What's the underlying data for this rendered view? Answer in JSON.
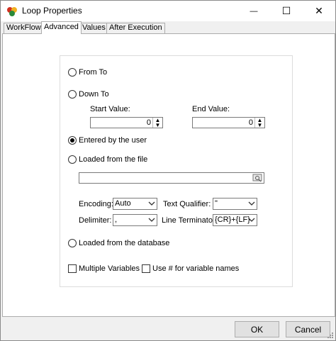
{
  "window": {
    "title": "Loop Properties",
    "minimize_glyph": "—",
    "maximize_glyph": "☐",
    "close_glyph": "✕"
  },
  "tabs": [
    {
      "label": "WorkFlow",
      "active": false
    },
    {
      "label": "Advanced",
      "active": true
    },
    {
      "label": "Values",
      "active": false
    },
    {
      "label": "After Execution",
      "active": false
    }
  ],
  "loop_options": {
    "from_to": {
      "label": "From To",
      "selected": false
    },
    "down_to": {
      "label": "Down To",
      "selected": false
    },
    "start_value": {
      "label": "Start Value:",
      "value": "0"
    },
    "end_value": {
      "label": "End Value:",
      "value": "0"
    },
    "entered_by_user": {
      "label": "Entered by the user",
      "selected": true
    },
    "loaded_from_file": {
      "label": "Loaded from the file",
      "selected": false
    },
    "file_path": {
      "value": ""
    },
    "encoding": {
      "label": "Encoding:",
      "value": "Auto"
    },
    "text_qualifier": {
      "label": "Text Qualifier:",
      "value": "\""
    },
    "delimiter": {
      "label": "Delimiter:",
      "value": ","
    },
    "line_terminator": {
      "label": "Line Terminator:",
      "value": "{CR}+{LF}"
    },
    "loaded_from_database": {
      "label": "Loaded from the database",
      "selected": false
    },
    "multiple_variables": {
      "label": "Multiple Variables",
      "checked": false
    },
    "use_hash": {
      "label": "Use # for variable names",
      "checked": false
    }
  },
  "footer": {
    "ok_label": "OK",
    "cancel_label": "Cancel"
  },
  "icons": {
    "app": "loop-app-icon",
    "browse": "folder-browse-icon",
    "dropdown": "chevron-down-icon",
    "spinner": "spin-arrows-icon"
  }
}
